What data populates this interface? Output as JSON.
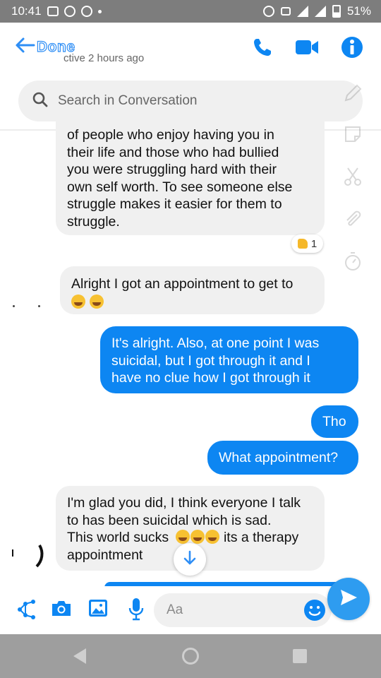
{
  "status_bar": {
    "time": "10:41",
    "battery": "51%"
  },
  "header": {
    "back_label": "Done",
    "subtitle": "ctive 2 hours ago"
  },
  "search": {
    "placeholder": "Search in Conversation"
  },
  "messages": [
    {
      "sender": "them",
      "lines": [
        "of people who enjoy having you in",
        "their life and those who had bullied",
        "you were struggling hard with their",
        "own self worth. To see someone else",
        "struggle makes it easier for them to",
        "struggle."
      ]
    },
    {
      "sender": "them",
      "text": "Alright I got an appointment to get to"
    },
    {
      "sender": "me",
      "lines": [
        "It's alright. Also, at one point I was",
        "suicidal, but I got through it and I",
        "have no clue how I got through it"
      ]
    },
    {
      "sender": "me",
      "text": "Tho"
    },
    {
      "sender": "me",
      "text": "What appointment?"
    },
    {
      "sender": "them",
      "lines": [
        "I'm glad you did, I think everyone I talk",
        "to has been suicidal which is sad.",
        "This world sucks",
        "its a therapy",
        "appointment"
      ]
    }
  ],
  "reaction": {
    "count": "1"
  },
  "composer": {
    "placeholder": "Aa"
  },
  "colors": {
    "accent": "#0d86f2",
    "incoming_bubble": "#f0f0f0",
    "status_bar": "#7d7d7d"
  }
}
